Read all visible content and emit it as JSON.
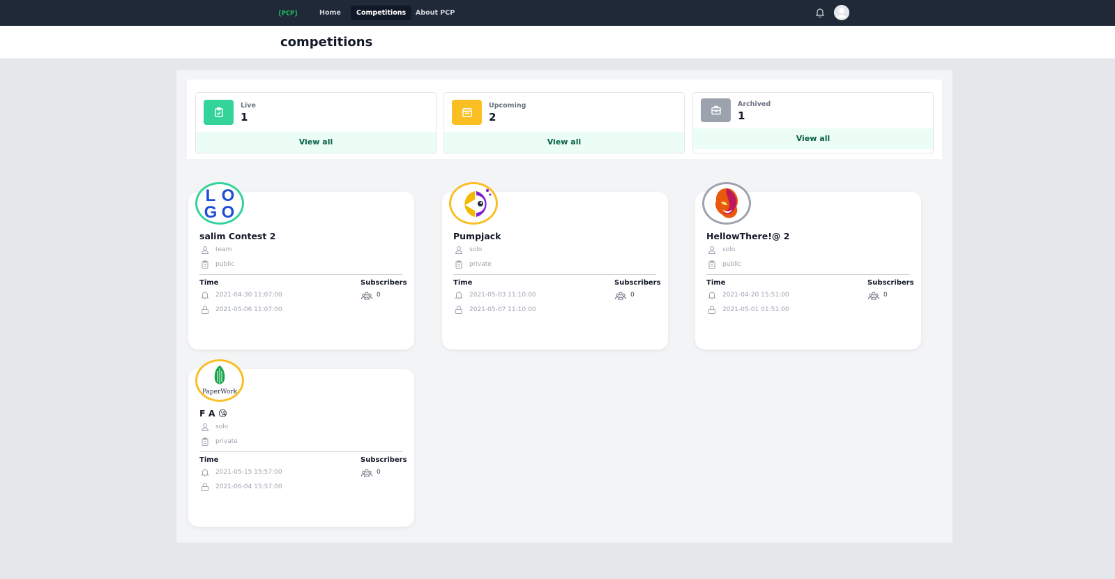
{
  "nav": {
    "logo_text": "{PCP}",
    "links": [
      "Home",
      "Competitions",
      "About PCP"
    ]
  },
  "page": {
    "title": "competitions"
  },
  "stats": [
    {
      "label": "Live",
      "count": "1",
      "action": "View all",
      "color": "#34d399",
      "icon": "clipboard-check-icon"
    },
    {
      "label": "Upcoming",
      "count": "2",
      "action": "View all",
      "color": "#fbbf24",
      "icon": "calendar-icon"
    },
    {
      "label": "Archived",
      "count": "1",
      "action": "View all",
      "color": "#9ca3af",
      "icon": "briefcase-icon"
    }
  ],
  "competitions": [
    {
      "title": "salim Contest 2",
      "mode": "team",
      "visibility": "public",
      "time_label": "Time",
      "start": "2021-04-30 11:07:00",
      "end": "2021-05-06 11:07:00",
      "subs_label": "Subscribers",
      "subscribers": "0",
      "logo_text": "LOGO",
      "ring_color": "#34d399"
    },
    {
      "title": "Pumpjack",
      "mode": "solo",
      "visibility": "private",
      "time_label": "Time",
      "start": "2021-05-03 11:10:00",
      "end": "2021-05-07 11:10:00",
      "subs_label": "Subscribers",
      "subscribers": "0",
      "logo_text": "",
      "ring_color": "#fbbf24"
    },
    {
      "title": "HellowThere!@ 2",
      "mode": "solo",
      "visibility": "public",
      "time_label": "Time",
      "start": "2021-04-20 15:51:00",
      "end": "2021-05-01 01:51:00",
      "subs_label": "Subscribers",
      "subscribers": "0",
      "logo_text": "",
      "ring_color": "#9ca3af"
    },
    {
      "title": "F A 😘",
      "mode": "solo",
      "visibility": "private",
      "time_label": "Time",
      "start": "2021-05-15 15:57:00",
      "end": "2021-06-04 15:57:00",
      "subs_label": "Subscribers",
      "subscribers": "0",
      "logo_text": "PaperWork",
      "ring_color": "#fbbf24"
    }
  ]
}
